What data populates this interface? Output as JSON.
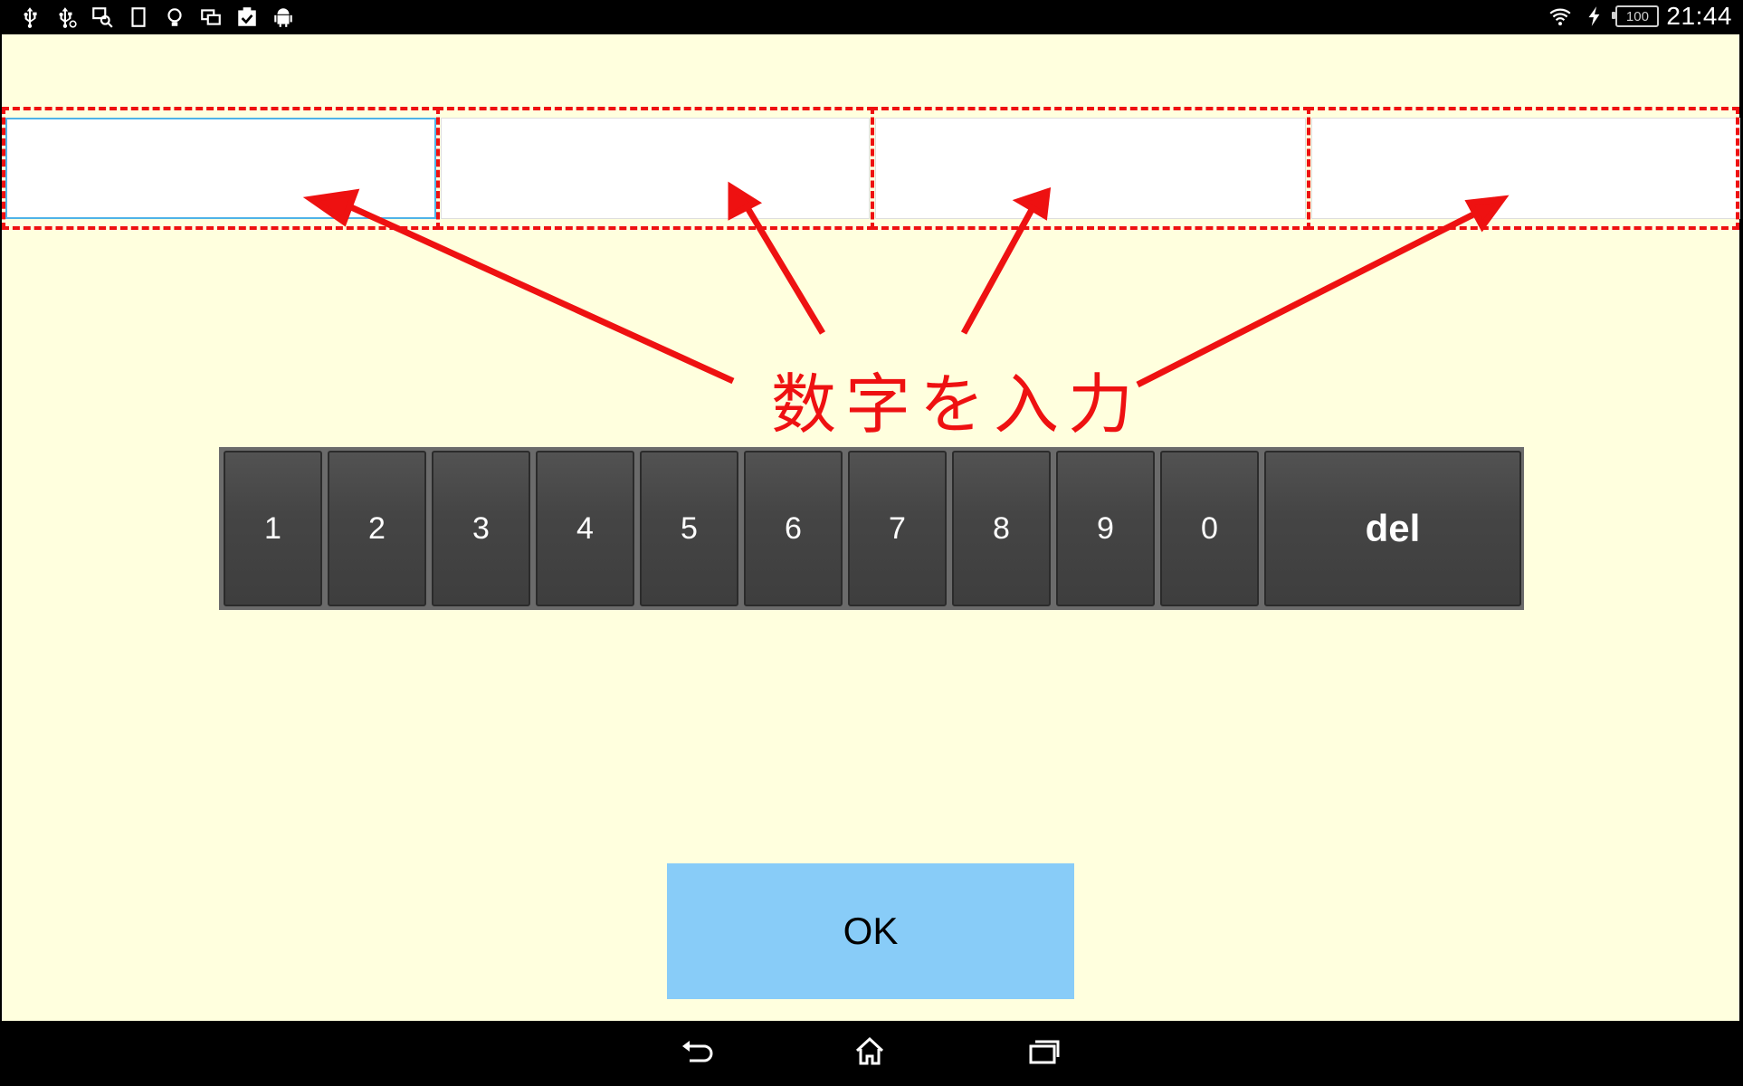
{
  "status_bar": {
    "left_icons": [
      "usb-icon",
      "usb-debug-icon",
      "screen-search-icon",
      "phone-outline-icon",
      "lightbulb-icon",
      "screens-icon",
      "task-check-icon",
      "android-icon"
    ],
    "battery_level": "100",
    "time": "21:44"
  },
  "input_fields": [
    {
      "value": "",
      "focused": true
    },
    {
      "value": "",
      "focused": false
    },
    {
      "value": "",
      "focused": false
    },
    {
      "value": "",
      "focused": false
    }
  ],
  "annotation": {
    "label": "数字を入力",
    "color": "#ee1111"
  },
  "keypad": {
    "keys": [
      "1",
      "2",
      "3",
      "4",
      "5",
      "6",
      "7",
      "8",
      "9",
      "0"
    ],
    "delete_label": "del"
  },
  "ok_button": {
    "label": "OK",
    "color": "#88ccf8"
  },
  "nav_bar": {
    "buttons": [
      "back-icon",
      "home-icon",
      "recent-apps-icon"
    ]
  },
  "colors": {
    "background": "#ffffde",
    "key": "#444444",
    "focus": "#4fb3e8"
  }
}
